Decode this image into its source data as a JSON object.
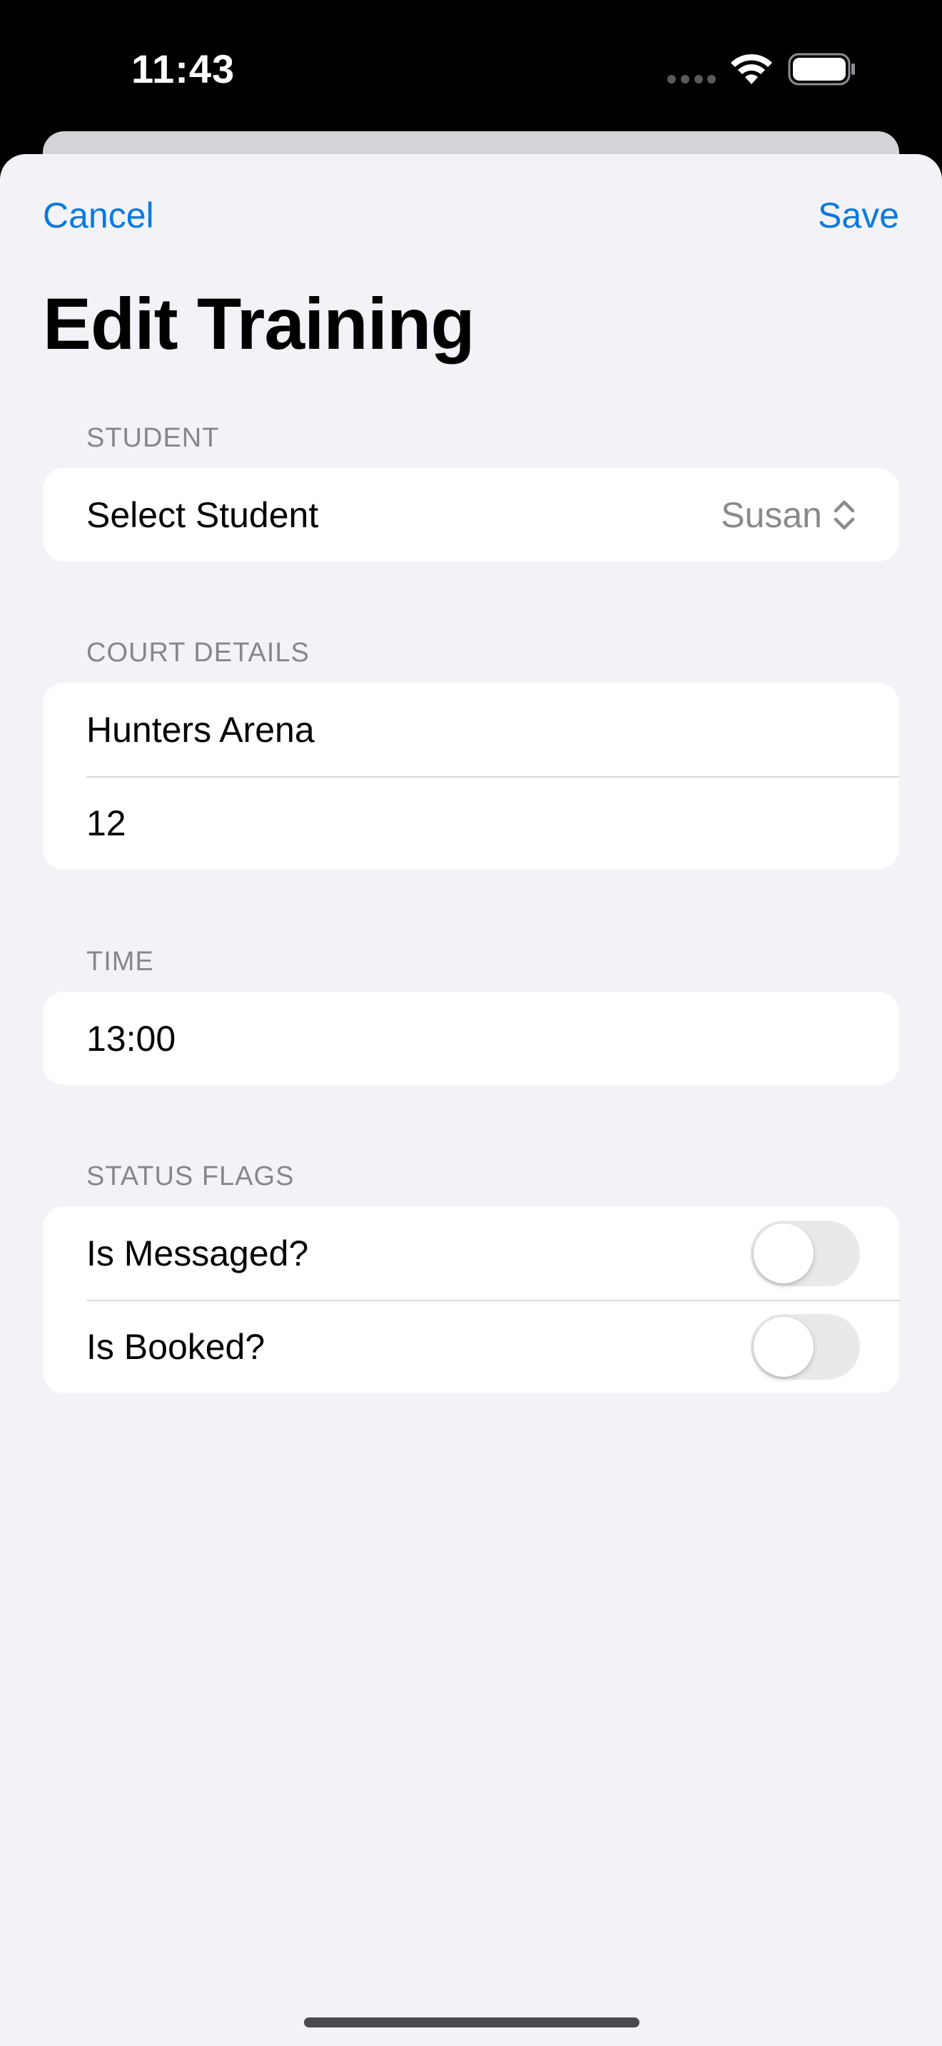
{
  "status_bar": {
    "time": "11:43"
  },
  "nav": {
    "cancel_label": "Cancel",
    "save_label": "Save",
    "title": "Edit Training"
  },
  "sections": {
    "student": {
      "header": "STUDENT",
      "select_label": "Select Student",
      "selected_value": "Susan"
    },
    "court_details": {
      "header": "COURT DETAILS",
      "court_name": "Hunters Arena",
      "court_number": "12"
    },
    "time": {
      "header": "TIME",
      "value": "13:00"
    },
    "status_flags": {
      "header": "STATUS FLAGS",
      "messaged_label": "Is Messaged?",
      "messaged_on": false,
      "booked_label": "Is Booked?",
      "booked_on": false
    }
  },
  "colors": {
    "accent": "#0a7ae0",
    "background": "#f2f2f7",
    "card": "#ffffff",
    "secondary_text": "#86868b",
    "toggle_off": "#e9e9eb"
  },
  "icons": {
    "picker": "chevron-updown-icon",
    "wifi": "wifi-icon",
    "battery": "battery-icon",
    "cellular": "cellular-signal-icon"
  }
}
